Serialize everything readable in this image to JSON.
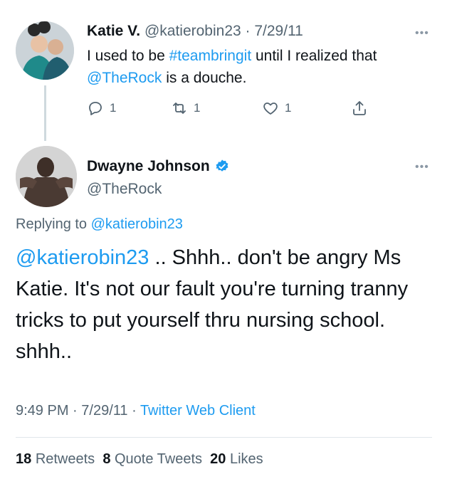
{
  "parent_tweet": {
    "display_name": "Katie V.",
    "handle": "@katierobin23",
    "date": "7/29/11",
    "text_before": "I used to be ",
    "hashtag": "#teambringit",
    "text_middle": " until I realized that ",
    "mention": "@TheRock",
    "text_after": " is a douche.",
    "reply_count": "1",
    "retweet_count": "1",
    "like_count": "1",
    "icons": [
      "reply-icon",
      "retweet-icon",
      "like-icon",
      "share-icon",
      "more-icon"
    ]
  },
  "main_tweet": {
    "display_name": "Dwayne Johnson",
    "verified": true,
    "handle": "@TheRock",
    "replying_label": "Replying to",
    "replying_handle": "@katierobin23",
    "body_mention": "@katierobin23",
    "body_text": " .. Shhh.. don't be angry Ms Katie. It's not our fault you're turning tranny tricks to put yourself thru nursing school. shhh..",
    "time": "9:49 PM",
    "date": "7/29/11",
    "client": "Twitter Web Client",
    "retweets_count": "18",
    "retweets_label": "Retweets",
    "quotes_count": "8",
    "quotes_label": "Quote Tweets",
    "likes_count": "20",
    "likes_label": "Likes"
  },
  "colors": {
    "link": "#1d9bf0",
    "muted": "#536471",
    "verified": "#1d9bf0"
  }
}
